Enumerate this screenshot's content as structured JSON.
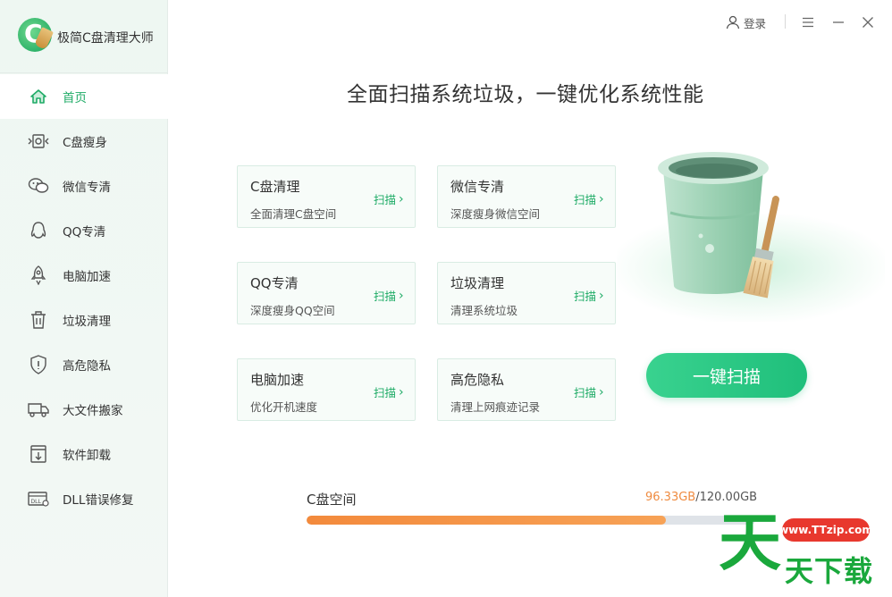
{
  "app": {
    "title": "极简C盘清理大师"
  },
  "window": {
    "login_label": "登录"
  },
  "sidebar": {
    "items": [
      {
        "label": "首页",
        "icon": "home-icon",
        "active": true
      },
      {
        "label": "C盘瘦身",
        "icon": "disk-slim-icon"
      },
      {
        "label": "微信专清",
        "icon": "wechat-icon"
      },
      {
        "label": "QQ专清",
        "icon": "qq-icon"
      },
      {
        "label": "电脑加速",
        "icon": "rocket-icon"
      },
      {
        "label": "垃圾清理",
        "icon": "trash-icon"
      },
      {
        "label": "高危隐私",
        "icon": "shield-icon"
      },
      {
        "label": "大文件搬家",
        "icon": "truck-icon"
      },
      {
        "label": "软件卸载",
        "icon": "uninstall-icon"
      },
      {
        "label": "DLL错误修复",
        "icon": "dll-icon"
      }
    ]
  },
  "main": {
    "headline": "全面扫描系统垃圾，一键优化系统性能",
    "scan_label": "扫描",
    "cards": [
      {
        "title": "C盘清理",
        "subtitle": "全面清理C盘空间"
      },
      {
        "title": "微信专清",
        "subtitle": "深度瘦身微信空间"
      },
      {
        "title": "QQ专清",
        "subtitle": "深度瘦身QQ空间"
      },
      {
        "title": "垃圾清理",
        "subtitle": "清理系统垃圾"
      },
      {
        "title": "电脑加速",
        "subtitle": "优化开机速度"
      },
      {
        "title": "高危隐私",
        "subtitle": "清理上网痕迹记录"
      }
    ],
    "one_click_scan": "一键扫描"
  },
  "disk": {
    "label": "C盘空间",
    "used": "96.33GB",
    "separator": "/",
    "total": "120.00GB",
    "used_fraction": 0.8
  },
  "watermark": {
    "url": "www.TTzip.com",
    "big": "天",
    "small": "天下载"
  },
  "colors": {
    "accent": "#1eab66",
    "button": "#2bc987",
    "disk_used": "#f38a3c",
    "watermark_red": "#e8382e",
    "watermark_green": "#1aa83c"
  }
}
